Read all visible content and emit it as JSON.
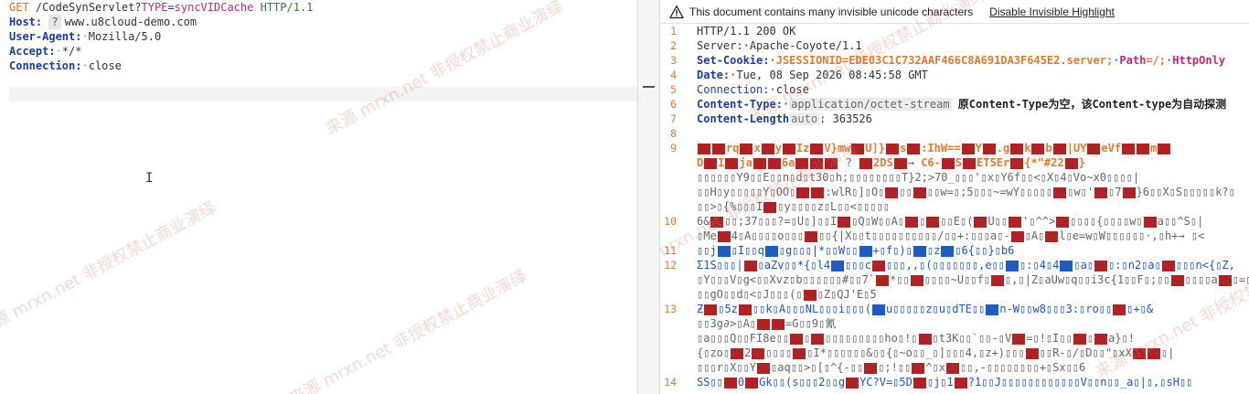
{
  "request": {
    "method": "GET",
    "path": "/CodeSynServlet?",
    "param_name": "TYPE",
    "param_eq": "=",
    "param_value": "syncVIDCache",
    "protocol": "HTTP/1.1",
    "headers": [
      {
        "name": "Host:",
        "badge": "?",
        "value": "www.u8cloud-demo.com"
      },
      {
        "name": "User-Agent:",
        "value": "Mozilla/5.0"
      },
      {
        "name": "Accept:",
        "value": "*/*"
      },
      {
        "name": "Connection:",
        "value": "close"
      }
    ]
  },
  "response": {
    "warning_text": "This document contains many invisible unicode characters",
    "warning_link": "Disable Invisible Highlight",
    "lines": {
      "status": "HTTP/1.1 200 OK",
      "server_name": "Server:",
      "server_val": "Apache-Coyote/1.1",
      "cookie_name": "Set-Cookie:",
      "cookie_val": "JSESSIONID=EDE03C1C732AAF466C8A691DA3F645E2.server;",
      "cookie_path": "Path",
      "cookie_path_val": "=/;",
      "cookie_httponly": "HttpOnly",
      "date_name": "Date:",
      "date_val": "Tue, 08 Sep 2026 08:45:58 GMT",
      "conn_name": "Connection:",
      "conn_val": "close",
      "ct_name": "Content-Type:",
      "ct_val": "application/octet-stream",
      "ct_note": "原Content-Type为空，该Content-type为自动探测",
      "cl_name": "Content-Length",
      "cl_badge": "auto",
      "cl_val": ": 363526"
    },
    "line_numbers": [
      "1",
      "2",
      "3",
      "4",
      "5",
      "6",
      "7",
      "8",
      "9",
      "10",
      "11",
      "12",
      "13",
      "14"
    ]
  },
  "watermark": "来源 mrxn.net 非授权禁止商业演绎",
  "colors": {
    "accent": "#e07b2c",
    "header_name": "#1b3e9e",
    "param": "#c8287a"
  }
}
